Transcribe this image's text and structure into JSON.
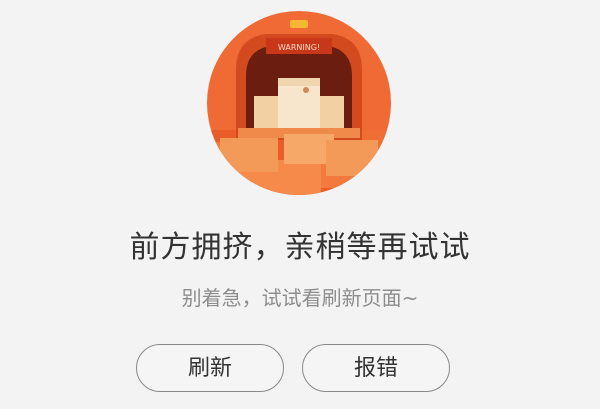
{
  "illustration": {
    "icon": "crowded-cart-illustration",
    "sign_text": "WARNING!",
    "colors": {
      "circle": "#f06a36",
      "circle_dark": "#d44a1f",
      "box": "#f5dcb8",
      "box_front": "#f0a060",
      "bg_boxes": "#e85d28"
    }
  },
  "message": {
    "title": "前方拥挤，亲稍等再试试",
    "subtitle": "别着急，试试看刷新页面~"
  },
  "buttons": {
    "refresh_label": "刷新",
    "report_label": "报错"
  }
}
